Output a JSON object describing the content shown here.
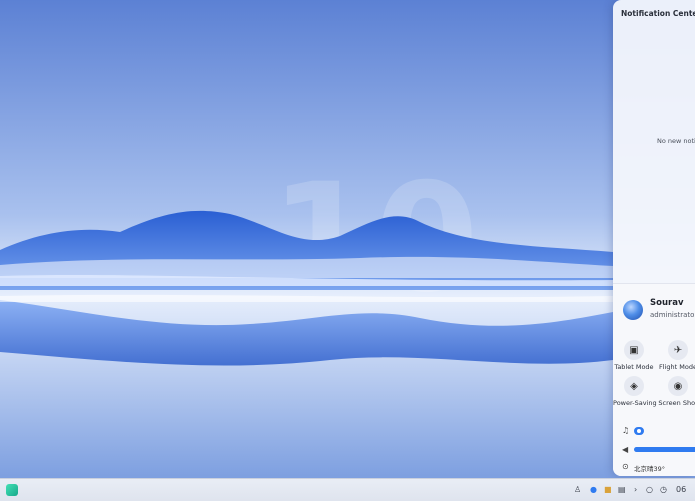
{
  "notification_center": {
    "title": "Notification Center",
    "empty_message": "No new notifications",
    "user": {
      "name": "Sourav",
      "role": "administrator"
    },
    "quick_tiles": [
      {
        "label": "Tablet Mode",
        "icon": "tablet-icon"
      },
      {
        "label": "Flight Mode",
        "icon": "airplane-icon"
      },
      {
        "label": "Power-Saving",
        "icon": "leaf-icon"
      },
      {
        "label": "Screen Shot",
        "icon": "camera-icon"
      }
    ],
    "weather": "北京晴39°"
  },
  "taskbar": {
    "clock_partial": "06"
  },
  "colors": {
    "accent": "#2f7bf0",
    "launcher": "#27c39e"
  }
}
